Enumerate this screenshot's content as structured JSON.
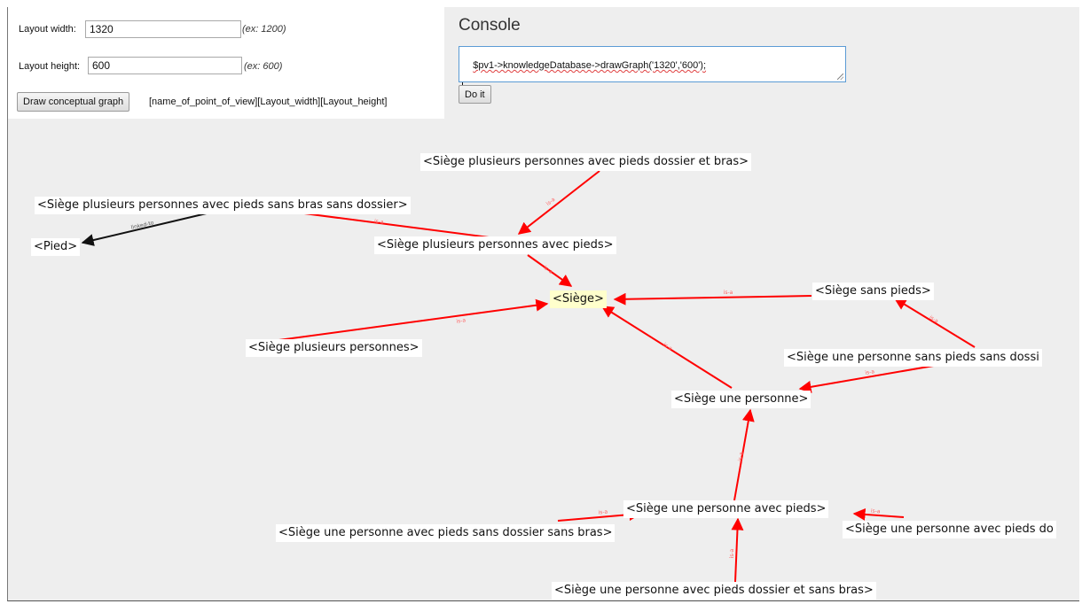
{
  "form": {
    "layout_width_label": "Layout width:",
    "layout_width_value": "1320",
    "layout_width_hint": "(ex: 1200)",
    "layout_height_label": "Layout height:",
    "layout_height_value": "600",
    "layout_height_hint": "(ex: 600)",
    "draw_button_label": "Draw conceptual graph",
    "signature": "[name_of_point_of_view][Layout_width][Layout_height]"
  },
  "console": {
    "title": "Console",
    "command": "$pv1->knowledgeDatabase->drawGraph('1320','600');",
    "do_it_label": "Do it"
  },
  "graph": {
    "nodes": [
      {
        "id": "n_multi_dossier_bras",
        "label": "<Siège plusieurs personnes avec pieds dossier et bras>"
      },
      {
        "id": "n_multi_sans_bras",
        "label": "<Siège plusieurs personnes avec pieds sans bras sans dossier>"
      },
      {
        "id": "n_pied",
        "label": "<Pied>"
      },
      {
        "id": "n_multi_pieds",
        "label": "<Siège plusieurs personnes avec pieds>"
      },
      {
        "id": "n_siege",
        "label": "<Siège>"
      },
      {
        "id": "n_sans_pieds",
        "label": "<Siège sans pieds>"
      },
      {
        "id": "n_multi",
        "label": "<Siège plusieurs personnes>"
      },
      {
        "id": "n_une_sans_pieds",
        "label": "<Siège une personne sans pieds sans dossi"
      },
      {
        "id": "n_une",
        "label": "<Siège une personne>"
      },
      {
        "id": "n_une_pieds",
        "label": "<Siège une personne avec pieds>"
      },
      {
        "id": "n_une_pieds_sans_dossier",
        "label": "<Siège une personne avec pieds sans dossier sans bras>"
      },
      {
        "id": "n_une_pieds_d",
        "label": "<Siège une personne avec pieds do"
      },
      {
        "id": "n_une_pieds_dossier_sans_bras",
        "label": "<Siège une personne avec pieds dossier et sans bras>"
      }
    ],
    "edges": [
      {
        "label": "is-a",
        "color": "#ff0000"
      },
      {
        "label": "is-a",
        "color": "#ff0000"
      },
      {
        "label": "linked-to",
        "color": "#111111"
      },
      {
        "label": "is-a",
        "color": "#ff0000"
      },
      {
        "label": "is-a",
        "color": "#ff0000"
      },
      {
        "label": "is-a",
        "color": "#ff0000"
      },
      {
        "label": "is-a",
        "color": "#ff0000"
      },
      {
        "label": "is-a",
        "color": "#ff0000"
      },
      {
        "label": "is-a",
        "color": "#ff0000"
      },
      {
        "label": "is-a",
        "color": "#ff0000"
      },
      {
        "label": "is-a",
        "color": "#ff0000"
      },
      {
        "label": "is-a",
        "color": "#ff0000"
      },
      {
        "label": "is-a",
        "color": "#ff0000"
      }
    ],
    "root_highlight_color": "#ffffcc"
  }
}
